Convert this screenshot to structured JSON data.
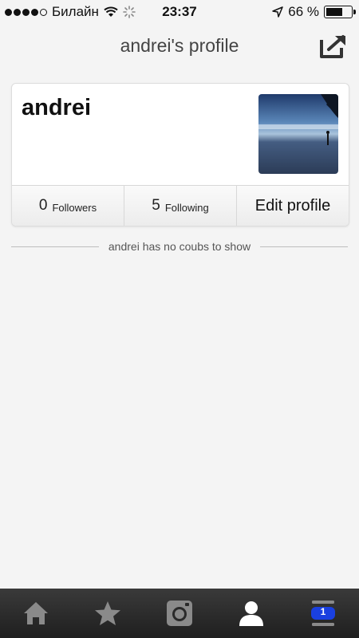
{
  "status_bar": {
    "carrier": "Билайн",
    "time": "23:37",
    "battery": "66 %",
    "battery_level": 0.66
  },
  "header": {
    "title": "andrei's profile"
  },
  "profile": {
    "name": "andrei",
    "stats": {
      "followers_count": "0",
      "followers_label": "Followers",
      "following_count": "5",
      "following_label": "Following",
      "edit_label": "Edit profile"
    }
  },
  "empty_message": "andrei has no coubs to show",
  "tab_bar": {
    "items": [
      "home-icon",
      "star-icon",
      "camera-icon",
      "person-icon",
      "notifications-icon"
    ],
    "notification_badge": "1",
    "active": "person-icon"
  }
}
